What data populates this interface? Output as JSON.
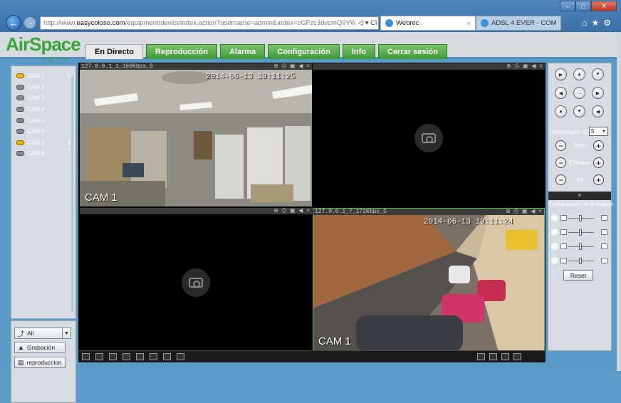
{
  "browser": {
    "address_prefix": "http://www.",
    "address_domain": "easycoloso.com",
    "address_rest": "/equipment/deviceIndex.action?username=admin&index=cGFzc3dvcmQ9YWRtaW4=&devSeq",
    "address_tail": "◁ ▾ C",
    "tab_active": "Webrec",
    "tab_other": "ADSL 4 EVER - COM",
    "close_glyph": "×"
  },
  "app": {
    "logo_main": "AirSpace",
    "logo_sub": "CCTV",
    "menu": [
      "En Directo",
      "Reproducción",
      "Alarma",
      "Configuración",
      "Info",
      "Cerrar sesión"
    ],
    "active_menu": "En Directo"
  },
  "cameras": [
    {
      "label": "CAM 1",
      "status": "S",
      "active": true
    },
    {
      "label": "CAM 2",
      "status": "",
      "active": false
    },
    {
      "label": "CAM 3",
      "status": "",
      "active": false
    },
    {
      "label": "CAM 4",
      "status": "",
      "active": false
    },
    {
      "label": "CAM 5",
      "status": "",
      "active": false
    },
    {
      "label": "CAM 6",
      "status": "",
      "active": false
    },
    {
      "label": "CAM 1",
      "status": "S",
      "active": true
    },
    {
      "label": "CAM 8",
      "status": "",
      "active": false
    }
  ],
  "controls": {
    "select_all": "All",
    "grabacion": "Grabación",
    "reproduccion": "reproduccion"
  },
  "panes": [
    {
      "header": "127.0.0.1_1_160Kbps_S",
      "timestamp": "2014-06-13 19:11:25",
      "cam_label": "CAM 1",
      "has_video": true
    },
    {
      "header": "",
      "timestamp": "",
      "cam_label": "",
      "has_video": false
    },
    {
      "header": "",
      "timestamp": "",
      "cam_label": "",
      "has_video": false
    },
    {
      "header": "127.0.0.1_7_172Kbps_S",
      "timestamp": "2014-06-13 19:11:24",
      "cam_label": "CAM 1",
      "has_video": true
    }
  ],
  "pane_icons": "⊕ ⎙ ▣ ◀ ×",
  "ptz": {
    "speed_label": "Velocidad(1-8):",
    "speed_value": "5",
    "zoom": "Zoom",
    "focus": "Enfoque",
    "iris": "Iris",
    "config_title": "Configuración de la imagen",
    "reset": "Reset"
  }
}
